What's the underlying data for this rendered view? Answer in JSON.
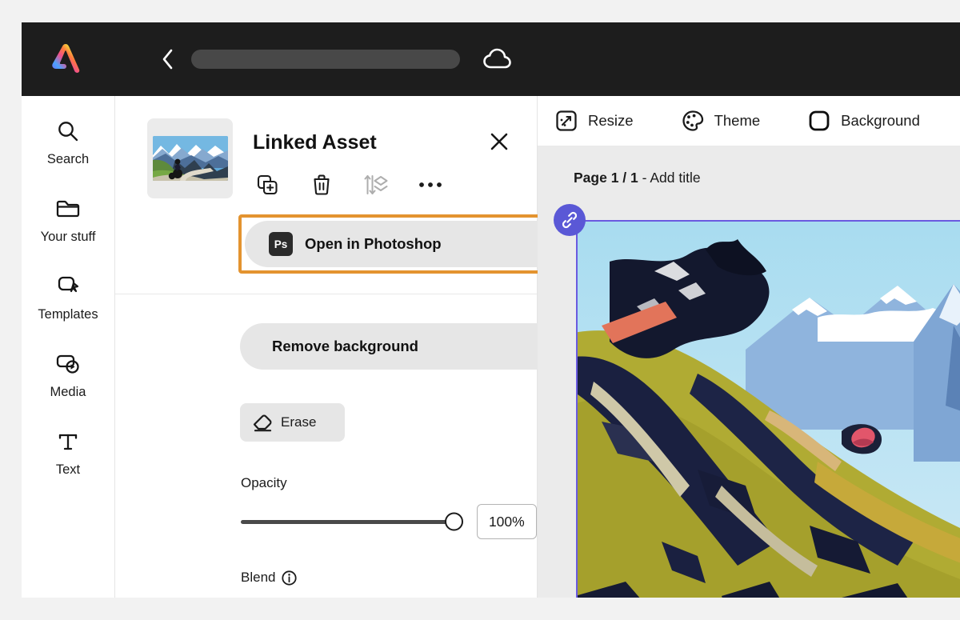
{
  "header": {
    "logo_icon": "adobe-express-logo",
    "back_icon": "chevron-left-icon",
    "title_placeholder": "",
    "cloud_icon": "cloud-icon"
  },
  "sidebar": {
    "items": [
      {
        "label": "Search",
        "icon": "search-icon"
      },
      {
        "label": "Your stuff",
        "icon": "folder-icon"
      },
      {
        "label": "Templates",
        "icon": "templates-icon"
      },
      {
        "label": "Media",
        "icon": "media-icon"
      },
      {
        "label": "Text",
        "icon": "text-icon"
      }
    ]
  },
  "panel": {
    "title": "Linked Asset",
    "close_icon": "close-icon",
    "thumbnail_alt": "motorcyclist on mountain road",
    "actions": [
      {
        "name": "duplicate",
        "icon": "duplicate-icon"
      },
      {
        "name": "delete",
        "icon": "trash-icon"
      },
      {
        "name": "arrange",
        "icon": "layers-arrange-icon"
      },
      {
        "name": "more",
        "icon": "more-options-icon"
      }
    ],
    "open_in_photoshop": {
      "label": "Open in Photoshop",
      "badge": "Ps",
      "highlight_color": "#e3932f"
    },
    "remove_background_label": "Remove background",
    "erase": {
      "label": "Erase",
      "icon": "eraser-icon"
    },
    "opacity": {
      "label": "Opacity",
      "value": "100%",
      "percent": 100
    },
    "blend": {
      "label": "Blend",
      "icon": "info-icon"
    }
  },
  "canvas": {
    "tools": [
      {
        "label": "Resize",
        "icon": "resize-icon"
      },
      {
        "label": "Theme",
        "icon": "palette-icon"
      },
      {
        "label": "Background",
        "icon": "background-icon"
      }
    ],
    "page_label_bold": "Page 1 / 1",
    "page_label_rest": " - Add title",
    "link_badge_icon": "link-icon",
    "selection_color": "#6a5ae0"
  },
  "colors": {
    "topbar_bg": "#1d1d1d",
    "accent_highlight": "#e3932f",
    "link_badge": "#5a58d6",
    "button_bg": "#e6e6e6"
  }
}
